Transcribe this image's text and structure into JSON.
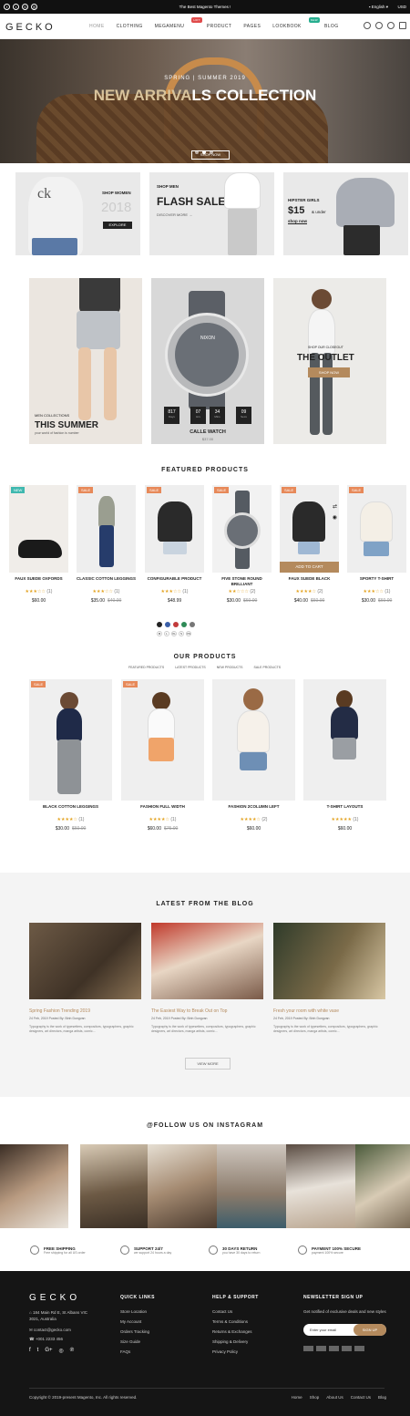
{
  "topbar": {
    "message": "The Best Magento Themes !",
    "language": "English",
    "currency": "USD"
  },
  "header": {
    "logo": "GECKO",
    "nav": [
      "HOME",
      "CLOTHING",
      "MEGAMENU",
      "PRODUCT",
      "PAGES",
      "LOOKBOOK",
      "BLOG"
    ],
    "badge_hot": "HOT",
    "badge_new": "NEW"
  },
  "hero": {
    "subtitle": "SPRING | SUMMER 2019",
    "title_a": "NEW ARRIVA",
    "title_b": "LS COLLECTION",
    "button": "SHOP NOW"
  },
  "banners": {
    "women": {
      "label": "SHOP WOMEN",
      "year": "2018",
      "button": "EXPLORE",
      "ck": "ck"
    },
    "men": {
      "label": "SHOP MEN",
      "title": "FLASH SALE",
      "link": "DISCOVER MORE →"
    },
    "girls": {
      "label": "HIPSTER GIRLS",
      "price": "$15",
      "under": "& under",
      "link": "shop now"
    }
  },
  "features": {
    "summer": {
      "label": "MEN COLLECTIONS",
      "title": "THIS SUMMER",
      "text": "your world of fashion is number"
    },
    "watch": {
      "brand": "NIXON",
      "countdown": [
        {
          "v": "817",
          "l": "Days"
        },
        {
          "v": "07",
          "l": "Hrs"
        },
        {
          "v": "34",
          "l": "Mins"
        },
        {
          "v": "09",
          "l": "Secs"
        }
      ],
      "name": "CALLE WATCH",
      "price": "$37.00"
    },
    "outlet": {
      "label": "SHOP OUR CLOSEOUT",
      "title": "THE OUTLET",
      "button": "SHOP NOW"
    }
  },
  "featured": {
    "title": "FEATURED PRODUCTS",
    "products": [
      {
        "tag": "NEW",
        "name": "FAUX SUEDE OXFORDS",
        "stars": "★★★☆☆",
        "count": "(1)",
        "price": "$60.00",
        "old": ""
      },
      {
        "tag": "SALE",
        "name": "CLASSIC COTTON LEGGINGS",
        "stars": "★★★☆☆",
        "count": "(1)",
        "price": "$35.00",
        "old": "$40.00"
      },
      {
        "tag": "SALE",
        "name": "CONFIGURABLE PRODUCT",
        "stars": "★★★☆☆",
        "count": "(1)",
        "price": "$48.99",
        "old": ""
      },
      {
        "tag": "SALE",
        "name": "FIVE STONE ROUND BRILLIANT",
        "stars": "★★☆☆☆",
        "count": "(2)",
        "price": "$30.00",
        "old": "$60.00"
      },
      {
        "tag": "SALE",
        "name": "FAUX SUEDE BLACK",
        "stars": "★★★★☆",
        "count": "(2)",
        "price": "$40.00",
        "old": "$60.00"
      },
      {
        "tag": "SALE",
        "name": "SPORTY T-SHIRT",
        "stars": "★★★☆☆",
        "count": "(1)",
        "price": "$30.00",
        "old": "$60.00"
      }
    ],
    "add_to_cart": "ADD TO CART",
    "sizes": [
      "M",
      "L",
      "XL",
      "S",
      "XS"
    ],
    "swatches": [
      "#222",
      "#3a5fa8",
      "#c23b3b",
      "#2e8b57",
      "#777"
    ]
  },
  "ours": {
    "title": "OUR PRODUCTS",
    "tabs": [
      "FEATURED PRODUCTS",
      "LATEST PRODUCTS",
      "NEW PRODUCTS",
      "SALE PRODUCTS"
    ],
    "products": [
      {
        "tag": "SALE",
        "name": "BLACK COTTON LEGGINGS",
        "stars": "★★★★☆",
        "count": "(1)",
        "price": "$30.00",
        "old": "$60.00"
      },
      {
        "tag": "SALE",
        "name": "FASHION FULL WIDTH",
        "stars": "★★★★☆",
        "count": "(1)",
        "price": "$60.00",
        "old": "$75.00"
      },
      {
        "tag": "",
        "name": "FASHION 2COLUMN LEFT",
        "stars": "★★★★☆",
        "count": "(2)",
        "price": "$60.00",
        "old": ""
      },
      {
        "tag": "",
        "name": "T-SHIRT LAYOUTS",
        "stars": "★★★★★",
        "count": "(1)",
        "price": "$60.00",
        "old": ""
      }
    ]
  },
  "blog": {
    "title": "LATEST FROM THE BLOG",
    "posts": [
      {
        "title": "Spring Fashion Trending 2019",
        "meta": "24 Feb, 2019    Posted By: Binh Dungvan",
        "text": "Typography is the work of typesetters, compositors, typographers, graphic designers, art directors, manga artists, comic..."
      },
      {
        "title": "The Easiest Way to Break Out on Top",
        "meta": "24 Feb, 2019    Posted By: Binh Dungvan",
        "text": "Typography is the work of typesetters, compositors, typographers, graphic designers, art directors, manga artists, comic..."
      },
      {
        "title": "Fresh your room with white vase",
        "meta": "24 Feb, 2019    Posted By: Binh Dungvan",
        "text": "Typography is the work of typesetters, compositors, typographers, graphic designers, art directors, manga artists, comic..."
      }
    ],
    "view_more": "VIEW MORE"
  },
  "instagram": {
    "title": "@FOLLOW US ON INSTAGRAM"
  },
  "services": [
    {
      "title": "FREE SHIPPING",
      "text": "Free shipping for all US order"
    },
    {
      "title": "SUPPORT 24/7",
      "text": "we support 24 hours a day"
    },
    {
      "title": "30 DAYS RETURN",
      "text": "you have 30 days to return"
    },
    {
      "title": "PAYMENT 100% SECURE",
      "text": "payment 100% secure"
    }
  ],
  "footer": {
    "logo": "GECKO",
    "address": "184 Main Rd E, St Albans VIC 3021, Australia",
    "email": "contact@gecko.com",
    "phone": "+001 2233 456",
    "quick_title": "QUICK LINKS",
    "quick": [
      "Store Location",
      "My Account",
      "Orders Tracking",
      "Size Guide",
      "FAQs"
    ],
    "help_title": "HELP & SUPPORT",
    "help": [
      "Contact Us",
      "Terms & Conditions",
      "Returns & Exchanges",
      "Shipping & Delivery",
      "Privacy Policy"
    ],
    "news_title": "NEWSLETTER SIGN UP",
    "news_text": "Get notified of exclusive deals and new styles",
    "email_placeholder": "Enter your email",
    "signup": "SIGN UP",
    "copyright": "Copyright © 2019-present Magento, Inc. All rights reserved.",
    "links": [
      "Home",
      "Shop",
      "About Us",
      "Contact Us",
      "Blog"
    ]
  }
}
